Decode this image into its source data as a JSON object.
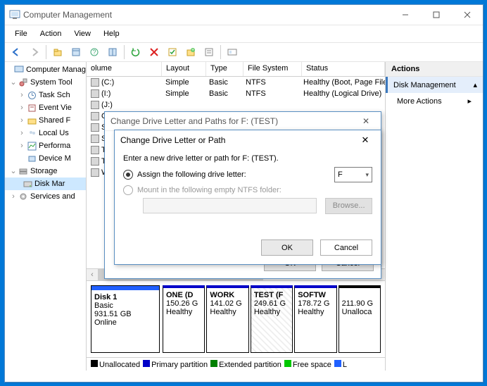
{
  "window": {
    "title": "Computer Management"
  },
  "menu": [
    "File",
    "Action",
    "View",
    "Help"
  ],
  "tree": {
    "root": "Computer Manag",
    "systemTools": "System Tool",
    "items": [
      "Task Sch",
      "Event Vie",
      "Shared F",
      "Local Us",
      "Performa",
      "Device M"
    ],
    "storage": "Storage",
    "diskMgmt": "Disk Mar",
    "services": "Services and"
  },
  "columns": [
    "olume",
    "Layout",
    "Type",
    "File System",
    "Status"
  ],
  "volumes": [
    {
      "n": "(C:)",
      "l": "Simple",
      "t": "Basic",
      "fs": "NTFS",
      "s": "Healthy (Boot, Page File, Cras"
    },
    {
      "n": "(I:)",
      "l": "Simple",
      "t": "Basic",
      "fs": "NTFS",
      "s": "Healthy (Logical Drive)"
    },
    {
      "n": "(J:)",
      "l": "",
      "t": "",
      "fs": "",
      "s": ""
    },
    {
      "n": "ONE",
      "l": "",
      "t": "",
      "fs": "",
      "s": ""
    },
    {
      "n": "SOFT",
      "l": "",
      "t": "",
      "fs": "",
      "s": ""
    },
    {
      "n": "Syste",
      "l": "",
      "t": "",
      "fs": "",
      "s": ""
    },
    {
      "n": "TEST",
      "l": "",
      "t": "",
      "fs": "",
      "s": ""
    },
    {
      "n": "TRAC",
      "l": "",
      "t": "",
      "fs": "",
      "s": ""
    },
    {
      "n": "WOR",
      "l": "",
      "t": "",
      "fs": "",
      "s": ""
    }
  ],
  "disk": {
    "name": "Disk 1",
    "type": "Basic",
    "size": "931.51 GB",
    "status": "Online",
    "parts": [
      {
        "n": "ONE (D",
        "s": "150.26 G",
        "h": "Healthy"
      },
      {
        "n": "WORK",
        "s": "141.02 G",
        "h": "Healthy"
      },
      {
        "n": "TEST (F",
        "s": "249.61 G",
        "h": "Healthy"
      },
      {
        "n": "SOFTW",
        "s": "178.72 G",
        "h": "Healthy"
      },
      {
        "n": "",
        "s": "211.90 G",
        "h": "Unalloca"
      }
    ]
  },
  "legend": [
    {
      "c": "#000",
      "t": "Unallocated"
    },
    {
      "c": "#0000c8",
      "t": "Primary partition"
    },
    {
      "c": "#008000",
      "t": "Extended partition"
    },
    {
      "c": "#00c800",
      "t": "Free space"
    },
    {
      "c": "#2060ff",
      "t": "L"
    }
  ],
  "actions": {
    "hdr": "Actions",
    "a": "Disk Management",
    "b": "More Actions"
  },
  "dlg1": {
    "title": "Change Drive Letter and Paths for F: (TEST)",
    "ok": "OK",
    "cancel": "Cancel"
  },
  "dlg2": {
    "title": "Change Drive Letter or Path",
    "prompt": "Enter a new drive letter or path for F: (TEST).",
    "opt1": "Assign the following drive letter:",
    "opt2": "Mount in the following empty NTFS folder:",
    "letter": "F",
    "browse": "Browse...",
    "ok": "OK",
    "cancel": "Cancel"
  }
}
